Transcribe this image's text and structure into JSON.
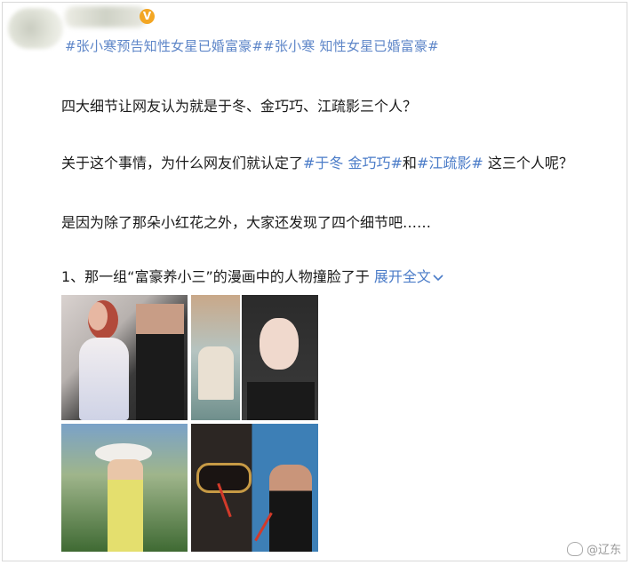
{
  "post": {
    "topic_line": "#张小寒预告知性女星已婚富豪##张小寒 知性女星已婚富豪#",
    "paragraph1": "四大细节让网友认为就是于冬、金巧巧、江疏影三个人？",
    "paragraph2": {
      "prefix": "关于这个事情，为什么网友们就认定了",
      "topic1": "#于冬 金巧巧#",
      "conj": "和",
      "topic2": "#江疏影#",
      "suffix": " 这三个人呢？"
    },
    "paragraph3": "是因为除了那朵小红花之外，大家还发现了四个细节吧……",
    "paragraph4": {
      "text": "1、那一组“富豪养小三”的漫画中的人物撞脸了于",
      "expand": "展开全文"
    }
  },
  "author": {
    "verified_badge": "V"
  },
  "watermark": {
    "text": "@辽东"
  },
  "colors": {
    "link": "#4b7cc8",
    "topic": "#5e86c8",
    "verified": "#f3a623"
  },
  "icons": {
    "verified": "verified-badge-icon",
    "expand": "chevron-down-icon",
    "weibo": "weibo-logo-icon"
  }
}
